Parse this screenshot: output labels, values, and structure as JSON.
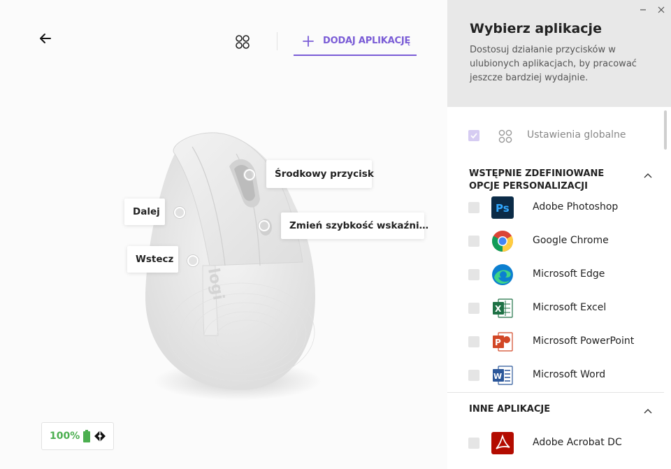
{
  "toolbar": {
    "add_app_label": "DODAJ APLIKACJĘ"
  },
  "device": {
    "callouts": {
      "middle": "Środkowy przycisk",
      "forward": "Dalej",
      "dpi": "Zmień szybkość wskaźni…",
      "back": "Wstecz"
    },
    "battery": "100%",
    "brand": "logi"
  },
  "panel": {
    "title": "Wybierz aplikacje",
    "description": "Dostosuj działanie przycisków w ulubionych aplikacjach, by pracować jeszcze bardziej wydajnie.",
    "global": {
      "label": "Ustawienia globalne",
      "checked": true
    },
    "predefined": {
      "title": "WSTĘPNIE ZDEFINIOWANE OPCJE PERSONALIZACJI",
      "apps": [
        {
          "name": "Adobe Photoshop",
          "icon": "photoshop-icon"
        },
        {
          "name": "Google Chrome",
          "icon": "chrome-icon"
        },
        {
          "name": "Microsoft Edge",
          "icon": "edge-icon"
        },
        {
          "name": "Microsoft Excel",
          "icon": "excel-icon"
        },
        {
          "name": "Microsoft PowerPoint",
          "icon": "powerpoint-icon"
        },
        {
          "name": "Microsoft Word",
          "icon": "word-icon"
        }
      ]
    },
    "other": {
      "title": "INNE APLIKACJE",
      "apps": [
        {
          "name": "Adobe Acrobat DC",
          "icon": "acrobat-icon"
        }
      ]
    }
  },
  "colors": {
    "accent": "#7a5cd6",
    "battery_ok": "#4caf50"
  }
}
